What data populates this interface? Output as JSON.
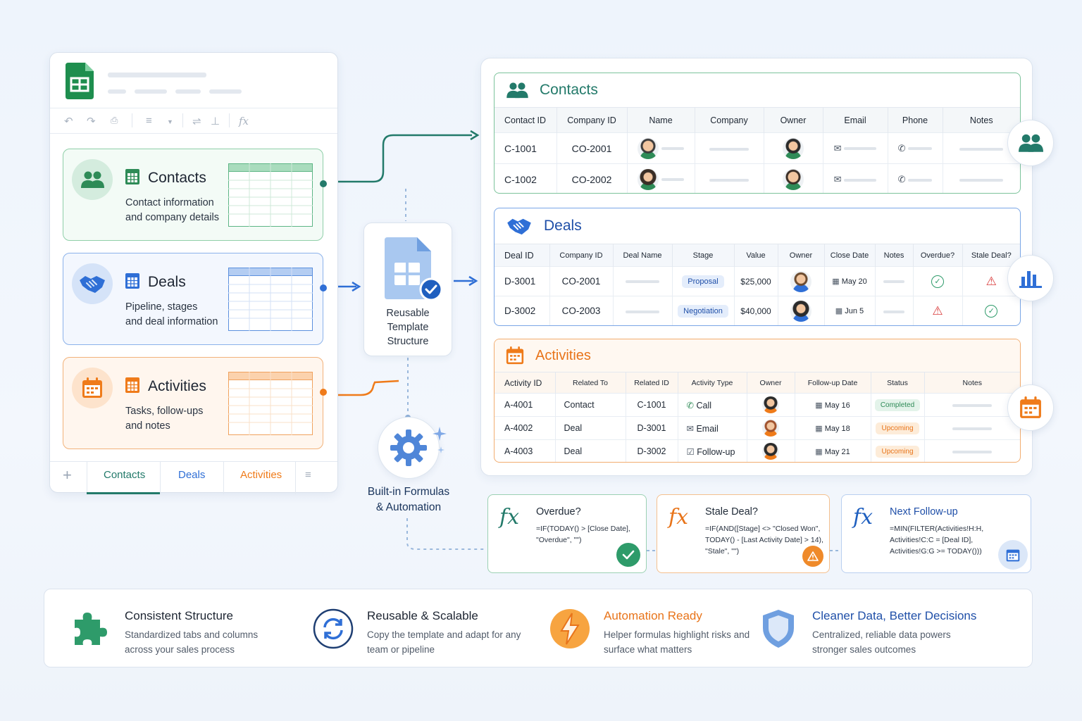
{
  "left_panel": {
    "cards": [
      {
        "title": "Contacts",
        "desc_line1": "Contact information",
        "desc_line2": "and company details",
        "color": "#2e8b57"
      },
      {
        "title": "Deals",
        "desc_line1": "Pipeline, stages",
        "desc_line2": "and deal information",
        "color": "#2f6fd6"
      },
      {
        "title": "Activities",
        "desc_line1": "Tasks, follow-ups",
        "desc_line2": "and notes",
        "color": "#ef7b1a"
      }
    ],
    "bottom_tabs": [
      "Contacts",
      "Deals",
      "Activities"
    ],
    "add_tab_symbol": "+",
    "menu_symbol": "≡"
  },
  "template": {
    "line1": "Reusable",
    "line2": "Template",
    "line3": "Structure"
  },
  "automation": {
    "line1": "Built-in Formulas",
    "line2": "& Automation"
  },
  "contacts": {
    "title": "Contacts",
    "headers": [
      "Contact ID",
      "Company ID",
      "Name",
      "Company",
      "Owner",
      "Email",
      "Phone",
      "Notes"
    ],
    "rows": [
      {
        "contact_id": "C-1001",
        "company_id": "CO-2001"
      },
      {
        "contact_id": "C-1002",
        "company_id": "CO-2002"
      }
    ]
  },
  "deals": {
    "title": "Deals",
    "headers": [
      "Deal ID",
      "Company ID",
      "Deal Name",
      "Stage",
      "Value",
      "Owner",
      "Close Date",
      "Notes",
      "Overdue?",
      "Stale Deal?"
    ],
    "rows": [
      {
        "deal_id": "D-3001",
        "company_id": "CO-2001",
        "stage": "Proposal",
        "value": "$25,000",
        "close_date": "May 20"
      },
      {
        "deal_id": "D-3002",
        "company_id": "CO-2003",
        "stage": "Negotiation",
        "value": "$40,000",
        "close_date": "Jun 5"
      }
    ]
  },
  "activities": {
    "title": "Activities",
    "headers": [
      "Activity ID",
      "Related To",
      "Related ID",
      "Activity Type",
      "Owner",
      "Follow-up Date",
      "Status",
      "Notes"
    ],
    "rows": [
      {
        "activity_id": "A-4001",
        "related_to": "Contact",
        "related_id": "C-1001",
        "type": "Call",
        "date": "May 16",
        "status": "Completed"
      },
      {
        "activity_id": "A-4002",
        "related_to": "Deal",
        "related_id": "D-3001",
        "type": "Email",
        "date": "May 18",
        "status": "Upcoming"
      },
      {
        "activity_id": "A-4003",
        "related_to": "Deal",
        "related_id": "D-3002",
        "type": "Follow-up",
        "date": "May 21",
        "status": "Upcoming"
      }
    ]
  },
  "formulas": [
    {
      "symbol": "fx",
      "title": "Overdue?",
      "code": "=IF(TODAY() > [Close Date],\n\"Overdue\", \"\")"
    },
    {
      "symbol": "fx",
      "title": "Stale Deal?",
      "code": "=IF(AND([Stage] <> \"Closed Won\",\nTODAY() - [Last Activity Date] > 14),\n\"Stale\", \"\")"
    },
    {
      "symbol": "fx",
      "title": "Next Follow-up",
      "code": "=MIN(FILTER(Activities!H:H,\nActivities!C:C = [Deal ID],\nActivities!G:G >= TODAY()))"
    }
  ],
  "benefits": [
    {
      "title": "Consistent Structure",
      "desc": "Standardized tabs and columns across your sales process",
      "color": "#1d2532"
    },
    {
      "title": "Reusable & Scalable",
      "desc": "Copy the template and adapt for any team or pipeline",
      "color": "#1d2532"
    },
    {
      "title": "Automation Ready",
      "desc": "Helper formulas highlight risks and surface what matters",
      "color": "#e8741a"
    },
    {
      "title": "Cleaner Data, Better Decisions",
      "desc": "Centralized, reliable data powers stronger sales outcomes",
      "color": "#1f4fa8"
    }
  ],
  "colors": {
    "green": "#2e8b57",
    "blue": "#2f6fd6",
    "orange": "#ef7b1a",
    "teal": "#237a6a"
  }
}
